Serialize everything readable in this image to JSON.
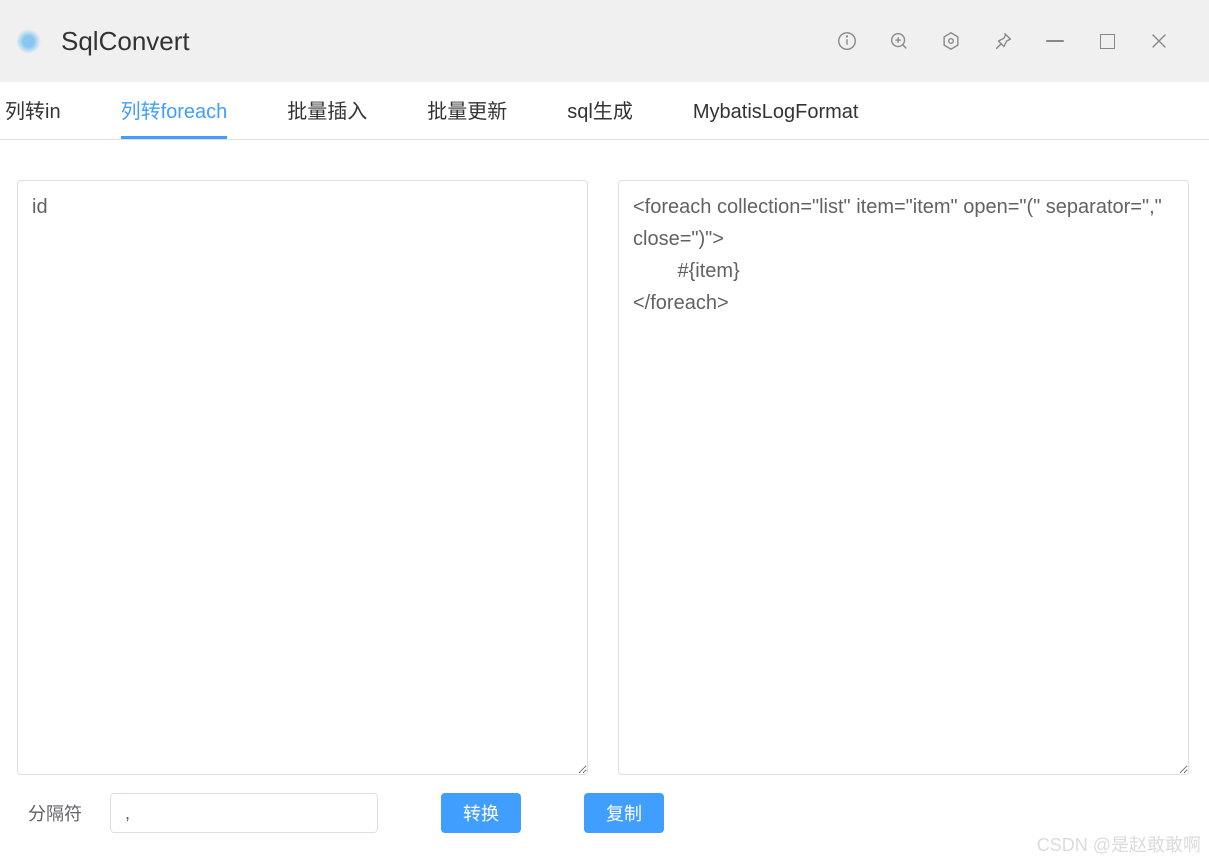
{
  "app": {
    "title": "SqlConvert"
  },
  "tabs": [
    {
      "label": "列转in",
      "active": false
    },
    {
      "label": "列转foreach",
      "active": true
    },
    {
      "label": "批量插入",
      "active": false
    },
    {
      "label": "批量更新",
      "active": false
    },
    {
      "label": "sql生成",
      "active": false
    },
    {
      "label": "MybatisLogFormat",
      "active": false
    }
  ],
  "editor": {
    "left_value": "id",
    "right_value": "<foreach collection=\"list\" item=\"item\" open=\"(\" separator=\",\" close=\")\">\n        #{item}\n</foreach>"
  },
  "separator": {
    "label": "分隔符",
    "value": ","
  },
  "buttons": {
    "convert": "转换",
    "copy": "复制"
  },
  "watermark": "CSDN @是赵敢敢啊",
  "window_icons": {
    "info": "info-icon",
    "zoom": "zoom-in-icon",
    "settings": "settings-icon",
    "pin": "pin-icon",
    "minimize": "minimize-icon",
    "maximize": "maximize-icon",
    "close": "close-icon"
  }
}
